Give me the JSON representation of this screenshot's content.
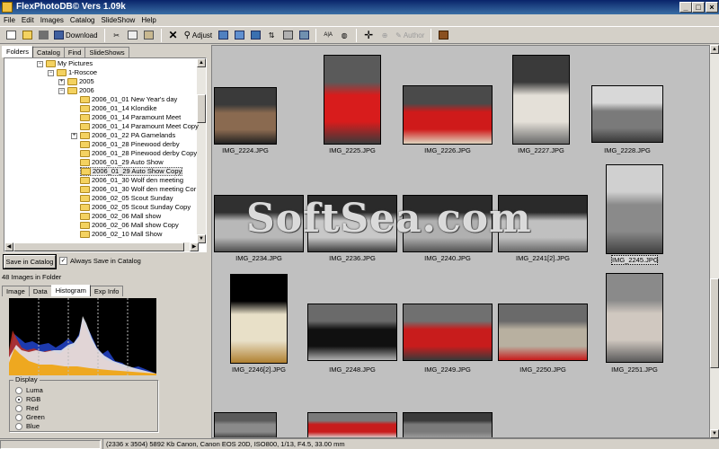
{
  "window": {
    "title": "FlexPhotoDB© Vers 1.09k"
  },
  "menu": [
    "File",
    "Edit",
    "Images",
    "Catalog",
    "SlideShow",
    "Help"
  ],
  "toolbar": {
    "download": "Download",
    "adjust": "Adjust",
    "author": "Author",
    "az": "A|A"
  },
  "left_tabs": [
    "Folders",
    "Catalog",
    "Find",
    "SlideShows"
  ],
  "tree": [
    {
      "label": "My Pictures",
      "depth": 0,
      "toggle": "−"
    },
    {
      "label": "1-Roscoe",
      "depth": 1,
      "toggle": "−"
    },
    {
      "label": "2005",
      "depth": 2,
      "toggle": "+"
    },
    {
      "label": "2006",
      "depth": 2,
      "toggle": "−"
    },
    {
      "label": "2006_01_01 New Year's day",
      "depth": 3
    },
    {
      "label": "2006_01_14 Klondike",
      "depth": 3
    },
    {
      "label": "2006_01_14 Paramount Meet",
      "depth": 3
    },
    {
      "label": "2006_01_14 Paramount Meet Copy",
      "depth": 3
    },
    {
      "label": "2006_01_22 PA Gamelands",
      "depth": 3,
      "toggle": "+"
    },
    {
      "label": "2006_01_28 Pinewood derby",
      "depth": 3
    },
    {
      "label": "2006_01_28 Pinewood derby Copy",
      "depth": 3
    },
    {
      "label": "2006_01_29 Auto Show",
      "depth": 3
    },
    {
      "label": "2006_01_29 Auto Show Copy",
      "depth": 3,
      "selected": true
    },
    {
      "label": "2006_01_30 Wolf den meeting",
      "depth": 3
    },
    {
      "label": "2006_01_30 Wolf den meeting Cor",
      "depth": 3
    },
    {
      "label": "2006_02_05 Scout Sunday",
      "depth": 3
    },
    {
      "label": "2006_02_05 Scout Sunday Copy",
      "depth": 3
    },
    {
      "label": "2006_02_06 Mall show",
      "depth": 3
    },
    {
      "label": "2006_02_06 Mall show Copy",
      "depth": 3
    },
    {
      "label": "2006_02_10 Mall Show",
      "depth": 3
    }
  ],
  "save_catalog_label": "Save in Catalog",
  "always_save_label": "Always Save in Catalog",
  "images_count": "48",
  "images_in_folder_label": "Images in Folder",
  "info_tabs": [
    "Image",
    "Data",
    "Histogram",
    "Exp Info"
  ],
  "display": {
    "legend": "Display",
    "options": [
      "Luma",
      "RGB",
      "Red",
      "Green",
      "Blue"
    ],
    "selected": "RGB"
  },
  "thumbnails": [
    {
      "name": "IMG_2224.JPG",
      "colors": [
        "#3a3a3a",
        "#8a6a50",
        "#202020"
      ]
    },
    {
      "name": "IMG_2225.JPG",
      "colors": [
        "#5a5a5a",
        "#d81c1c",
        "#3a3a3a"
      ]
    },
    {
      "name": "IMG_2226.JPG",
      "colors": [
        "#4a4a4a",
        "#cf1a1a",
        "#e0d6c0"
      ]
    },
    {
      "name": "IMG_2227.JPG",
      "colors": [
        "#3a3a3a",
        "#e4e0d8",
        "#6a6a6a"
      ]
    },
    {
      "name": "IMG_2228.JPG",
      "colors": [
        "#d8d8d8",
        "#7a7a7a",
        "#3a3a3a"
      ]
    },
    {
      "name": "IMG_2234.JPG",
      "colors": [
        "#303030",
        "#b8b8b8",
        "#505050"
      ]
    },
    {
      "name": "IMG_2236.JPG",
      "colors": [
        "#2a2a2a",
        "#c8c8c8",
        "#404040"
      ]
    },
    {
      "name": "IMG_2240.JPG",
      "colors": [
        "#2a2a2a",
        "#b0b0b0",
        "#555555"
      ]
    },
    {
      "name": "IMG_2241[2].JPG",
      "colors": [
        "#2a2a2a",
        "#c0c0c0",
        "#6a6a6a"
      ]
    },
    {
      "name": "IMG_2245.JPG",
      "colors": [
        "#d0d0d0",
        "#8a8a8a",
        "#404040"
      ],
      "selected": true
    },
    {
      "name": "IMG_2246[2].JPG",
      "colors": [
        "#000000",
        "#e8e0c8",
        "#b08030"
      ]
    },
    {
      "name": "IMG_2248.JPG",
      "colors": [
        "#6a6a6a",
        "#101010",
        "#b0b0b0"
      ]
    },
    {
      "name": "IMG_2249.JPG",
      "colors": [
        "#707070",
        "#c81c1c",
        "#3a3a3a"
      ]
    },
    {
      "name": "IMG_2250.JPG",
      "colors": [
        "#6a6a6a",
        "#b8b0a0",
        "#c81c1c"
      ]
    },
    {
      "name": "IMG_2251.JPG",
      "colors": [
        "#8a8a8a",
        "#d0c8c0",
        "#5a5a5a"
      ]
    },
    {
      "name": "",
      "colors": [
        "#5a5a5a",
        "#8a8a8a",
        "#3a3a3a"
      ]
    },
    {
      "name": "",
      "colors": [
        "#7a7a7a",
        "#c81c1c",
        "#e0e0e0"
      ]
    },
    {
      "name": "",
      "colors": [
        "#3a3a3a",
        "#7a7a7a",
        "#a0a0a0"
      ]
    }
  ],
  "watermark": "SoftSea.com",
  "status": {
    "text": "(2336 x 3504) 5892 Kb Canon, Canon EOS 20D, ISO800, 1/13, F4.5, 33.00 mm"
  }
}
